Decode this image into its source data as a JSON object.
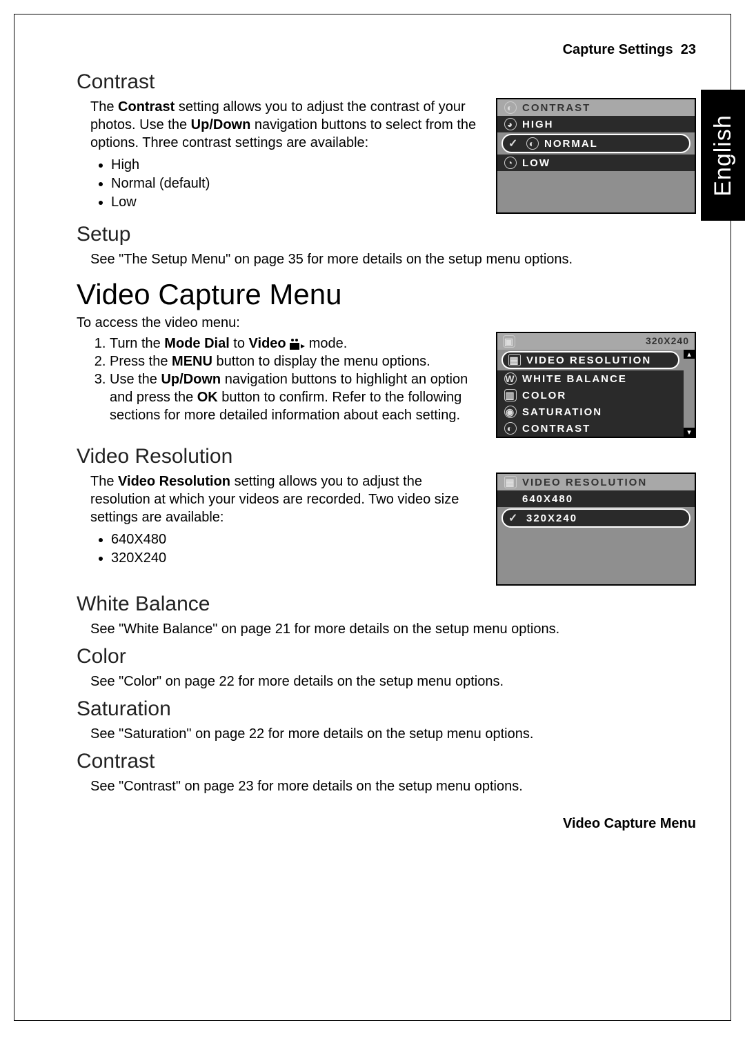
{
  "header": {
    "section": "Capture Settings",
    "page": "23"
  },
  "language": "English",
  "contrast": {
    "heading": "Contrast",
    "intro_a": "The ",
    "intro_bold1": "Contrast",
    "intro_b": " setting allows you to adjust the contrast of your photos. Use the ",
    "intro_bold2": "Up/Down",
    "intro_c": " navigation buttons to select from the options. Three contrast settings are available:",
    "opts": [
      "High",
      "Normal (default)",
      "Low"
    ],
    "lcd": {
      "title": "CONTRAST",
      "items": [
        "HIGH",
        "NORMAL",
        "LOW"
      ],
      "selected": "NORMAL"
    }
  },
  "setup": {
    "heading": "Setup",
    "text": "See \"The Setup Menu\" on page 35 for more details on the setup menu options."
  },
  "videoMenu": {
    "heading": "Video Capture Menu",
    "intro": "To access the video menu:",
    "step1_a": "Turn the ",
    "step1_b1": "Mode Dial",
    "step1_b": " to ",
    "step1_b2": "Video",
    "step1_c": " mode.",
    "step2_a": "Press the ",
    "step2_b": "MENU",
    "step2_c": " button to display the menu options.",
    "step3_a": "Use the ",
    "step3_b": "Up/Down",
    "step3_c": " navigation buttons to highlight an option and press the ",
    "step3_d": "OK",
    "step3_e": " button to confirm. Refer to the following sections for more detailed information about each setting.",
    "lcd": {
      "corner": "320X240",
      "items": [
        "VIDEO RESOLUTION",
        "WHITE BALANCE",
        "COLOR",
        "SATURATION",
        "CONTRAST"
      ],
      "selected": "VIDEO RESOLUTION"
    }
  },
  "videoRes": {
    "heading": "Video Resolution",
    "intro_a": "The ",
    "intro_bold": "Video Resolution",
    "intro_b": " setting allows you to adjust the resolution at which your videos are recorded. Two video size settings are available:",
    "opts": [
      "640X480",
      "320X240"
    ],
    "lcd": {
      "title": "VIDEO RESOLUTION",
      "items": [
        "640X480",
        "320X240"
      ],
      "selected": "320X240"
    }
  },
  "wb": {
    "heading": "White Balance",
    "text": "See \"White Balance\" on page 21 for more details on the setup menu options."
  },
  "color": {
    "heading": "Color",
    "text": "See \"Color\" on page 22 for more details on the setup menu options."
  },
  "sat": {
    "heading": "Saturation",
    "text": "See \"Saturation\" on page 22 for more details on the setup menu options."
  },
  "contrast2": {
    "heading": "Contrast",
    "text": "See \"Contrast\" on page 23 for more details on the setup menu options."
  },
  "footer": "Video Capture Menu"
}
